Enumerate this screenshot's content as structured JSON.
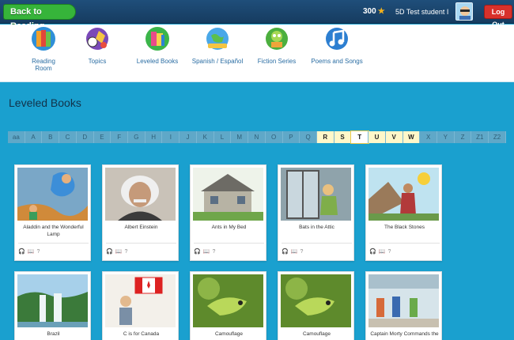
{
  "topbar": {
    "back_label": "Back to Reading",
    "stars": "300",
    "student": "5D Test student I",
    "logout": "Log Out"
  },
  "nav": [
    {
      "label": "Reading Room",
      "icon": "reading-room-icon"
    },
    {
      "label": "Topics",
      "icon": "topics-icon"
    },
    {
      "label": "Leveled Books",
      "icon": "leveled-books-icon"
    },
    {
      "label": "Spanish / Español",
      "icon": "spanish-globe-icon"
    },
    {
      "label": "Fiction Series",
      "icon": "fiction-series-icon"
    },
    {
      "label": "Poems and Songs",
      "icon": "poems-songs-icon"
    }
  ],
  "main": {
    "title": "Leveled Books"
  },
  "levels": [
    "aa",
    "A",
    "B",
    "C",
    "D",
    "E",
    "F",
    "G",
    "H",
    "I",
    "J",
    "K",
    "L",
    "M",
    "N",
    "O",
    "P",
    "Q",
    "R",
    "S",
    "T",
    "U",
    "V",
    "W",
    "X",
    "Y",
    "Z",
    "Z1",
    "Z2"
  ],
  "levels_available": [
    "R",
    "S",
    "T",
    "U",
    "V",
    "W"
  ],
  "level_selected": "T",
  "books": [
    {
      "title": "Aladdin and the Wonderful Lamp",
      "image": "aladdin-illustration"
    },
    {
      "title": "Albert Einstein",
      "image": "einstein-photo"
    },
    {
      "title": "Ants in My Bed",
      "image": "house-illustration"
    },
    {
      "title": "Bats in the Attic",
      "image": "attic-window-illustration"
    },
    {
      "title": "The Black Stones",
      "image": "black-stones-illustration"
    },
    {
      "title": "Brazil",
      "image": "waterfall-photo"
    },
    {
      "title": "C is for Canada",
      "image": "canada-illustration"
    },
    {
      "title": "Camouflage",
      "image": "chameleon-photo"
    },
    {
      "title": "Camouflage",
      "image": "chameleon-photo"
    },
    {
      "title": "Captain Morty Commands the",
      "image": "captain-morty-illustration"
    }
  ],
  "colors": {
    "accent": "#1aa0cf",
    "topbar": "#1f4e7a",
    "back_button": "#36b43a",
    "logout": "#d8312b"
  }
}
